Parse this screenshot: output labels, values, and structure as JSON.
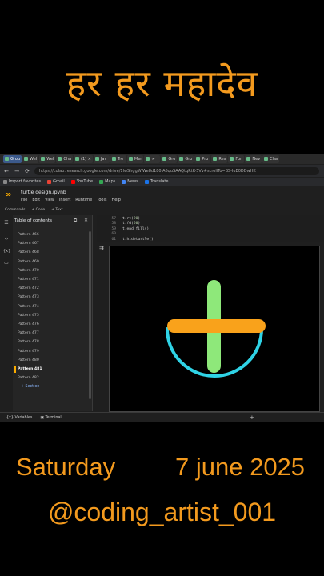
{
  "top_title": "हर हर महादेव",
  "tabs": [
    "Grou",
    "Wel",
    "Wel",
    "Cha",
    "(1) ×",
    "Jav",
    "Tre",
    "Mer",
    "∞",
    "Gro",
    "Gro",
    "Pro",
    "Res",
    "Fon",
    "Nev",
    "Cha"
  ],
  "address": {
    "back": "←",
    "forward": "→",
    "reload": "⟳",
    "url": "https://colab.research.google.com/drive/1lwShggWiWe8d180IA6quSAAQtqRtK-5Vv#scrollTo=BS-IuE0DDwHK"
  },
  "bookmarks": [
    "Import favorites",
    "Gmail",
    "YouTube",
    "Maps",
    "News",
    "Translate"
  ],
  "colab": {
    "logo": "∞",
    "notebook_name": "turtle design.ipynb",
    "menus": [
      "File",
      "Edit",
      "View",
      "Insert",
      "Runtime",
      "Tools",
      "Help"
    ],
    "toolbar": [
      "Commands",
      "+ Code",
      "+ Text"
    ]
  },
  "toc": {
    "title": "Table of contents",
    "items": [
      "Pattern 466",
      "Pattern 467",
      "Pattern 468",
      "Pattern 469",
      "Pattern 470",
      "Pattern 471",
      "Pattern 472",
      "Pattern 473",
      "Pattern 474",
      "Pattern 475",
      "Pattern 476",
      "Pattern 477",
      "Pattern 478",
      "Pattern 479",
      "Pattern 480",
      "Pattern 481",
      "Pattern 482"
    ],
    "active_item": "Pattern 481",
    "section_label": "+ Section"
  },
  "code": {
    "lines": [
      {
        "n": "57",
        "text": "t.rt(",
        "num": "90",
        "tail": ")"
      },
      {
        "n": "58",
        "text": "t.fd(",
        "num": "50",
        "tail": ")"
      },
      {
        "n": "59",
        "text": "t.end_fill()",
        "num": "",
        "tail": ""
      },
      {
        "n": "60",
        "text": "",
        "num": "",
        "tail": ""
      },
      {
        "n": "61",
        "text": "t.hideturtle()",
        "num": "",
        "tail": ""
      }
    ]
  },
  "drawing": {
    "bar_color": "#f9a21b",
    "pillar_color": "#8ee87a",
    "arc_color": "#2fd3e6",
    "background": "#000000"
  },
  "status": {
    "variables": "Variables",
    "terminal": "Terminal",
    "plus": "+"
  },
  "footer": {
    "day": "Saturday",
    "date": "7 june 2025",
    "handle": "@coding_artist_001"
  },
  "colors": {
    "accent_orange": "#f39a1e",
    "page_bg": "#000000"
  }
}
